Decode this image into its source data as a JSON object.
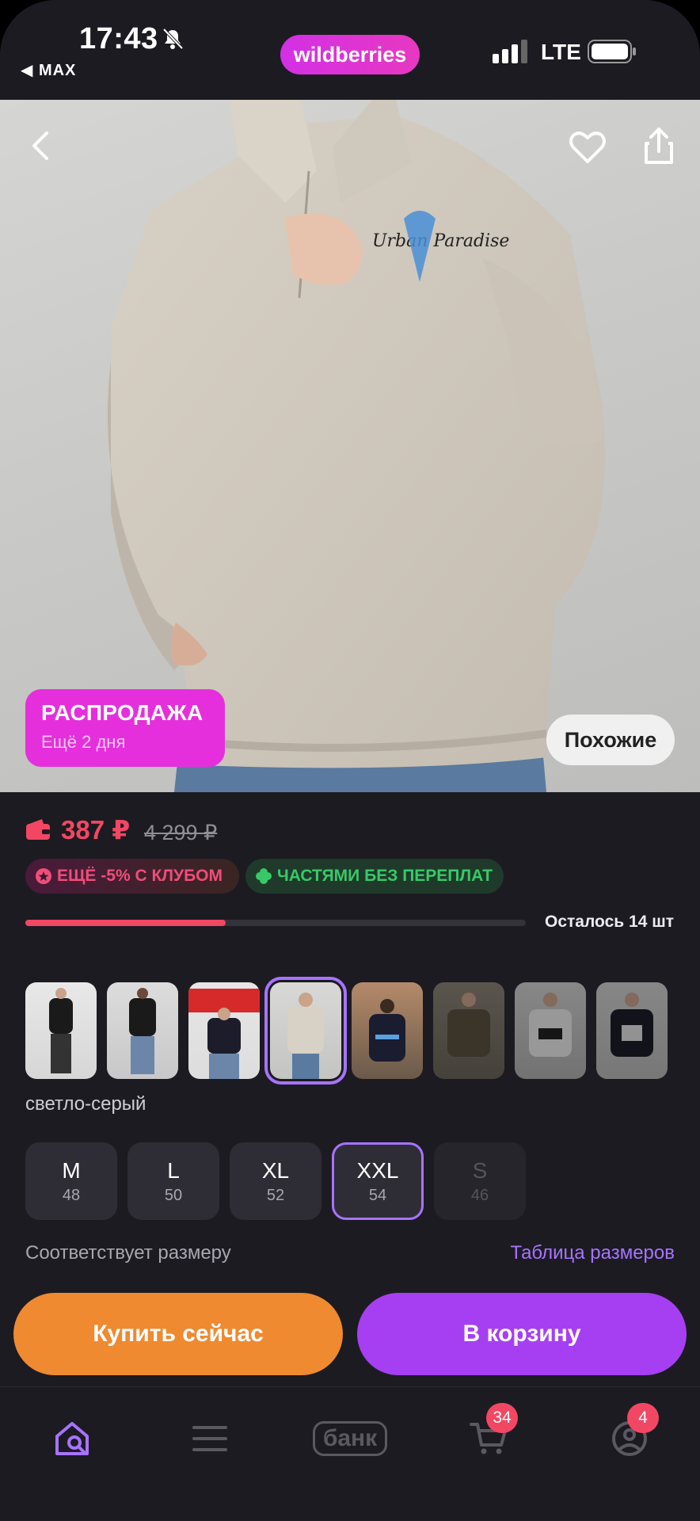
{
  "status": {
    "time": "17:43",
    "back_app": "◀ MAX",
    "network": "LTE"
  },
  "brand": {
    "logo": "wildberries"
  },
  "hero": {
    "sale_title": "РАСПРОДАЖА",
    "sale_sub": "Ещё 2 дня",
    "similar": "Похожие",
    "icons": [
      "back-icon",
      "heart-icon",
      "share-icon"
    ]
  },
  "price": {
    "current": "387 ₽",
    "old": "4 299 ₽",
    "chip_club": "ЕЩЁ -5% С КЛУБОМ",
    "chip_parts": "ЧАСТЯМИ БЕЗ ПЕРЕПЛАТ",
    "stock_text": "Осталось 14 шт",
    "stock_fraction": 0.4
  },
  "variants": {
    "color_name": "светло-серый",
    "sizes": [
      {
        "size": "M",
        "ru": "48"
      },
      {
        "size": "L",
        "ru": "50"
      },
      {
        "size": "XL",
        "ru": "52"
      },
      {
        "size": "XXL",
        "ru": "54"
      },
      {
        "size": "S",
        "ru": "46"
      }
    ],
    "fit_text": "Соответствует размеру",
    "size_table": "Таблица размеров"
  },
  "actions": {
    "buy_now": "Купить сейчас",
    "to_cart": "В корзину"
  },
  "tabbar": {
    "bank": "банк",
    "cart_count": "34",
    "profile_count": "4"
  },
  "colors": {
    "accent": "#a773ff",
    "price": "#f24763",
    "buy": "#ef8a30",
    "cart": "#a63ff1",
    "sale": "#e62fdc"
  }
}
